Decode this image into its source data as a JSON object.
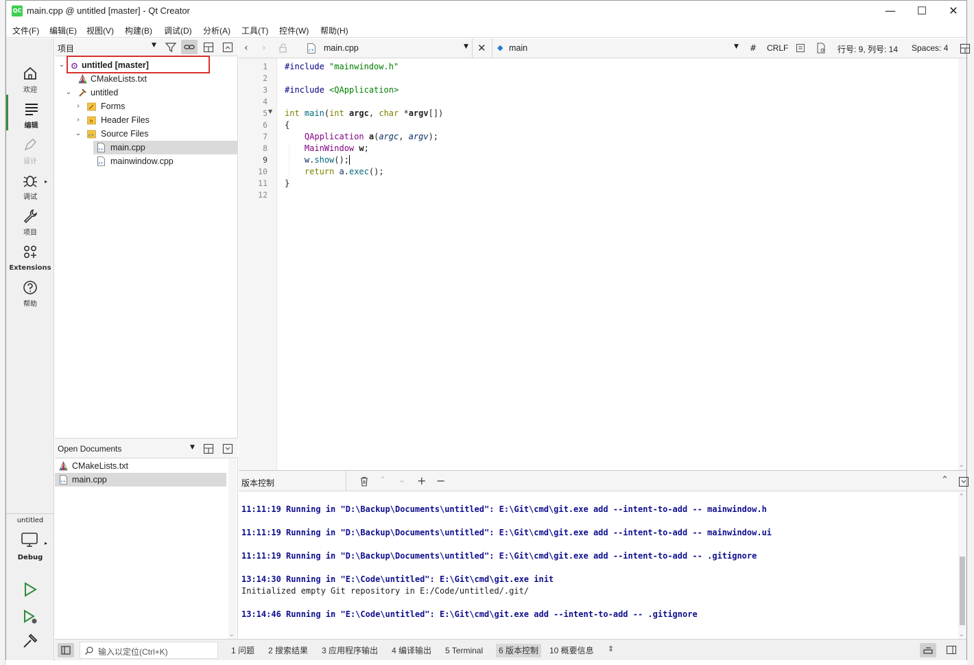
{
  "window": {
    "title": "main.cpp @ untitled [master] - Qt Creator",
    "logo_text": "QC",
    "min": "—",
    "max": "☐",
    "close": "✕"
  },
  "menu": [
    "文件(F)",
    "编辑(E)",
    "视图(V)",
    "构建(B)",
    "调试(D)",
    "分析(A)",
    "工具(T)",
    "控件(W)",
    "帮助(H)"
  ],
  "modes": {
    "welcome": "欢迎",
    "edit": "编辑",
    "design": "设计",
    "debug": "调试",
    "projects": "项目",
    "extensions": "Extensions",
    "help": "帮助",
    "kit_project": "untitled",
    "kit_build": "Debug"
  },
  "project_pane": {
    "title": "项目",
    "tree": [
      {
        "label": "untitled [master]",
        "level": 0,
        "expanded": true,
        "kind": "project"
      },
      {
        "label": "CMakeLists.txt",
        "level": 1,
        "kind": "cmake"
      },
      {
        "label": "untitled",
        "level": 1,
        "expanded": true,
        "kind": "target"
      },
      {
        "label": "Forms",
        "level": 2,
        "expanded": false,
        "kind": "forms"
      },
      {
        "label": "Header Files",
        "level": 2,
        "expanded": false,
        "kind": "headers"
      },
      {
        "label": "Source Files",
        "level": 2,
        "expanded": true,
        "kind": "sources"
      },
      {
        "label": "main.cpp",
        "level": 3,
        "kind": "cpp",
        "selected": true
      },
      {
        "label": "mainwindow.cpp",
        "level": 3,
        "kind": "cpp"
      }
    ]
  },
  "open_documents": {
    "title": "Open Documents",
    "items": [
      {
        "label": "CMakeLists.txt",
        "selected": false
      },
      {
        "label": "main.cpp",
        "selected": true
      }
    ]
  },
  "editor_toolbar": {
    "file": "main.cpp",
    "symbol": "main",
    "hash": "#",
    "line_ending": "CRLF",
    "position": "行号: 9, 列号: 14",
    "indent": "Spaces: 4"
  },
  "editor": {
    "line_numbers": [
      "1",
      "2",
      "3",
      "4",
      "5",
      "6",
      "7",
      "8",
      "9",
      "10",
      "11",
      "12"
    ],
    "current_line": 9
  },
  "vcs": {
    "title": "版本控制",
    "log": [
      "11:11:19 Running in \"D:\\Backup\\Documents\\untitled\": E:\\Git\\cmd\\git.exe add --intent-to-add -- mainwindow.h",
      "11:11:19 Running in \"D:\\Backup\\Documents\\untitled\": E:\\Git\\cmd\\git.exe add --intent-to-add -- mainwindow.ui",
      "11:11:19 Running in \"D:\\Backup\\Documents\\untitled\": E:\\Git\\cmd\\git.exe add --intent-to-add -- .gitignore",
      "13:14:30 Running in \"E:\\Code\\untitled\": E:\\Git\\cmd\\git.exe init",
      "Initialized empty Git repository in E:/Code/untitled/.git/",
      "13:14:46 Running in \"E:\\Code\\untitled\": E:\\Git\\cmd\\git.exe add --intent-to-add -- .gitignore"
    ]
  },
  "statusbar": {
    "locator_placeholder": "输入以定位(Ctrl+K)",
    "tabs": [
      {
        "label": "1  问题",
        "active": false
      },
      {
        "label": "2  搜索结果",
        "active": false
      },
      {
        "label": "3  应用程序输出",
        "active": false
      },
      {
        "label": "4  编译输出",
        "active": false
      },
      {
        "label": "5  Terminal",
        "active": false
      },
      {
        "label": "6  版本控制",
        "active": true
      },
      {
        "label": "10  概要信息",
        "active": false
      }
    ]
  },
  "colors": {
    "accent_green": "#41cd52",
    "highlight_box": "#d9302c"
  }
}
